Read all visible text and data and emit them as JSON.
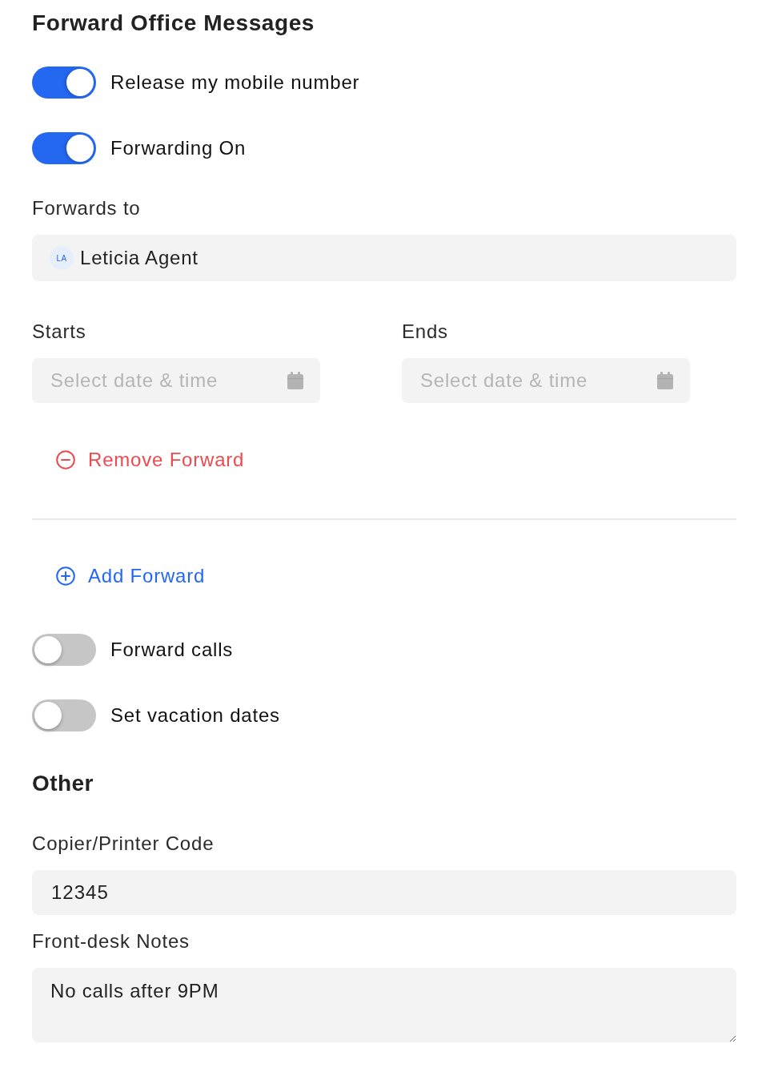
{
  "forward_office_messages": {
    "title": "Forward Office Messages",
    "toggles": [
      {
        "label": "Release my mobile number",
        "on": true
      },
      {
        "label": "Forwarding On",
        "on": true
      }
    ],
    "forwards_to": {
      "label": "Forwards to",
      "initials": "LA",
      "value": "Leticia Agent"
    },
    "schedule": [
      {
        "label": "Starts",
        "placeholder": "Select date & time"
      },
      {
        "label": "Ends",
        "placeholder": "Select date & time"
      }
    ],
    "remove_forward": {
      "label": "Remove Forward"
    },
    "add_forward": {
      "label": "Add Forward"
    },
    "more_toggles": [
      {
        "label": "Forward calls",
        "on": false
      },
      {
        "label": "Set vacation dates",
        "on": false
      }
    ]
  },
  "other": {
    "title": "Other",
    "copier_code": {
      "label": "Copier/Printer Code",
      "value": "12345"
    },
    "front_desk_notes": {
      "label": "Front-desk Notes",
      "value": "No calls after 9PM"
    }
  }
}
